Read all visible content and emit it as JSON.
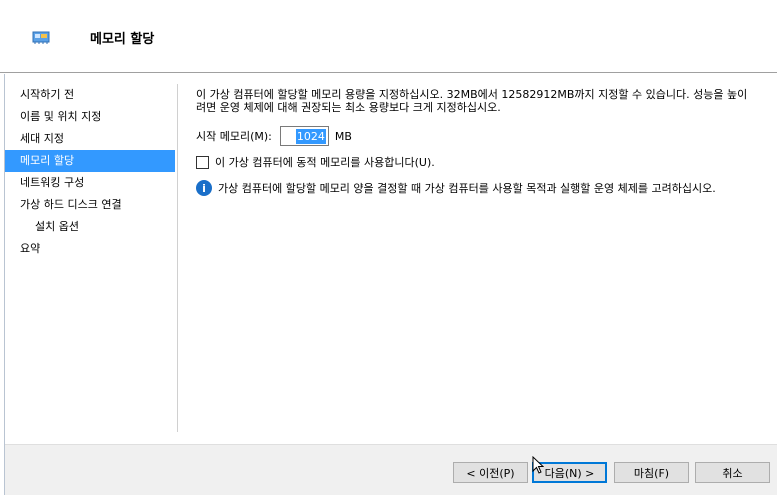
{
  "header": {
    "title": "메모리 할당",
    "icon": "memory-chip-icon"
  },
  "nav": {
    "items": [
      {
        "label": "시작하기 전",
        "selected": false,
        "sub": false
      },
      {
        "label": "이름 및 위치 지정",
        "selected": false,
        "sub": false
      },
      {
        "label": "세대 지정",
        "selected": false,
        "sub": false
      },
      {
        "label": "메모리 할당",
        "selected": true,
        "sub": false
      },
      {
        "label": "네트워킹 구성",
        "selected": false,
        "sub": false
      },
      {
        "label": "가상 하드 디스크 연결",
        "selected": false,
        "sub": false
      },
      {
        "label": "설치 옵션",
        "selected": false,
        "sub": true
      },
      {
        "label": "요약",
        "selected": false,
        "sub": false
      }
    ]
  },
  "content": {
    "description_line1": "이 가상 컴퓨터에 할당할 메모리 용량을 지정하십시오. 32MB에서 12582912MB까지 지정할 수 있습니다. 성능을 높이",
    "description_line2": "려면 운영 체제에 대해 권장되는 최소 용량보다 크게 지정하십시오.",
    "startup_memory_label": "시작 메모리(M):",
    "startup_memory_value": "1024",
    "startup_memory_unit": "MB",
    "dynamic_memory_label": "이 가상 컴퓨터에 동적 메모리를 사용합니다(U).",
    "dynamic_memory_checked": false,
    "info_text": "가상 컴퓨터에 할당할 메모리 양을 결정할 때 가상 컴퓨터를 사용할 목적과 실행할 운영 체제를 고려하십시오."
  },
  "footer": {
    "prev_label": "< 이전(P)",
    "next_label": "다음(N) >",
    "finish_label": "마침(F)",
    "cancel_label": "취소"
  },
  "colors": {
    "selection": "#3399ff",
    "info_icon": "#1a6fc9",
    "default_button_border": "#0078d7"
  }
}
